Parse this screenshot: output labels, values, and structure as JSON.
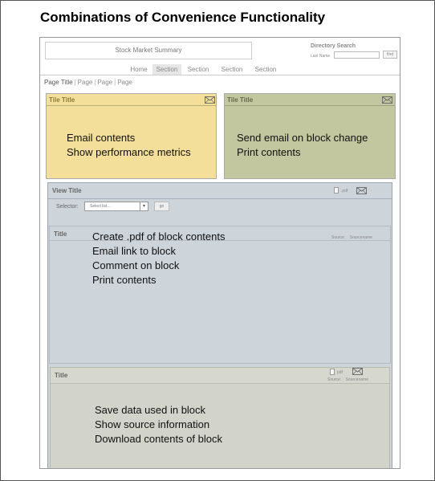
{
  "doc_title": "Combinations of Convenience Functionality",
  "masthead": {
    "title": "Stock Market Summary"
  },
  "directory_search": {
    "label": "Directory Search",
    "last_name_label": "Last Name",
    "last_name_value": "",
    "find_label": "find"
  },
  "nav": {
    "tabs": [
      {
        "label": "Home",
        "active": false
      },
      {
        "label": "Section",
        "active": true
      },
      {
        "label": "Section",
        "active": false
      },
      {
        "label": "Section",
        "active": false
      },
      {
        "label": "Section",
        "active": false
      }
    ]
  },
  "breadcrumb": {
    "items": [
      "Page Title",
      "Page",
      "Page",
      "Page"
    ],
    "separator": "|"
  },
  "tile_left": {
    "title": "Tile Title",
    "icon": "envelope-icon",
    "color": "#f3df99",
    "lines": [
      "Email contents",
      "Show performance metrics"
    ]
  },
  "tile_right": {
    "title": "Tile Title",
    "icon": "envelope-icon",
    "color": "#c3c79f",
    "lines": [
      "Send email on block change",
      "Print contents"
    ]
  },
  "view": {
    "title": "View Title",
    "pdf_label": ".pdf",
    "selector_label": "Selector:",
    "select_value": "Select list...",
    "go_label": "go",
    "color": "#cdd4da"
  },
  "block1": {
    "title": "Title",
    "source_label": "Source:",
    "source_name": "Sourcename",
    "lines": [
      "Create .pdf of block contents",
      "Email link to block",
      "Comment on block",
      "Print contents"
    ]
  },
  "block2": {
    "title": "Title",
    "pdf_label": "pdf",
    "source_label": "Source:",
    "source_name": "Sourcename",
    "color": "#d2d3cb",
    "lines": [
      "Save data used in block",
      "Show source information",
      "Download contents of block"
    ]
  }
}
